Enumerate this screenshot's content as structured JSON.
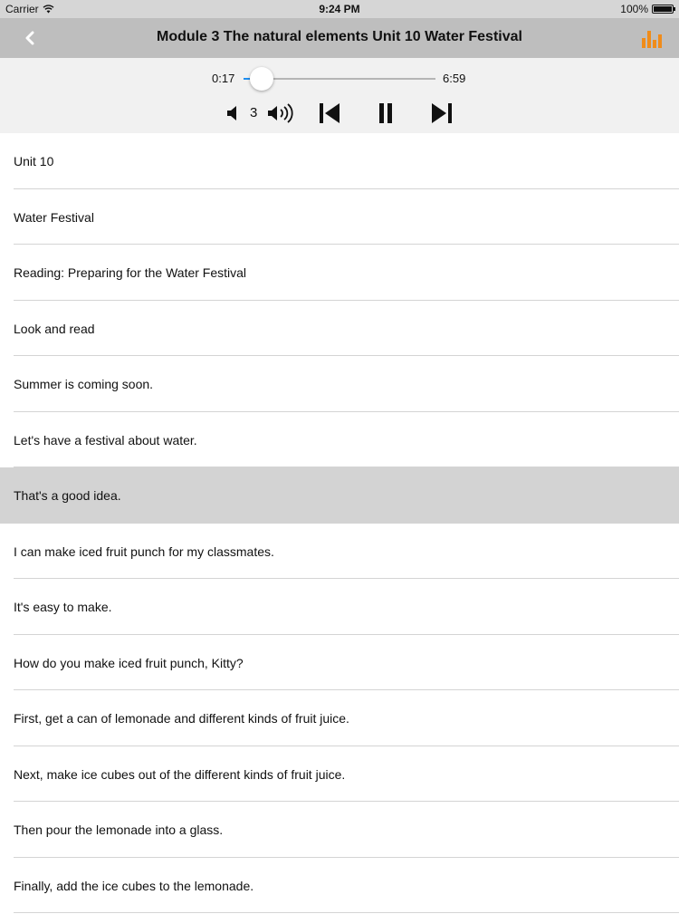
{
  "status_bar": {
    "carrier": "Carrier",
    "time": "9:24 PM",
    "battery": "100%"
  },
  "nav": {
    "title": "Module 3 The natural elements Unit 10 Water Festival",
    "back_icon": "chevron-left-icon",
    "stats_icon": "bar-chart-icon",
    "accent_color": "#f08c1a"
  },
  "player": {
    "current_time": "0:17",
    "duration": "6:59",
    "progress_fraction": 0.04,
    "volume_level": "3",
    "is_playing": true
  },
  "lines": [
    "Unit 10",
    "Water Festival",
    "Reading: Preparing for the Water Festival",
    "Look and read",
    "Summer is coming soon.",
    "Let's have a festival about water.",
    "That's a good idea.",
    "I can make iced fruit punch for my classmates.",
    "It's easy to make.",
    "How do you make iced fruit punch, Kitty?",
    "First, get a can of lemonade and different kinds of fruit juice.",
    "Next, make ice cubes out of the different kinds of fruit juice.",
    "Then pour the lemonade into a glass.",
    "Finally, add the ice cubes to the lemonade."
  ],
  "active_line_index": 6
}
